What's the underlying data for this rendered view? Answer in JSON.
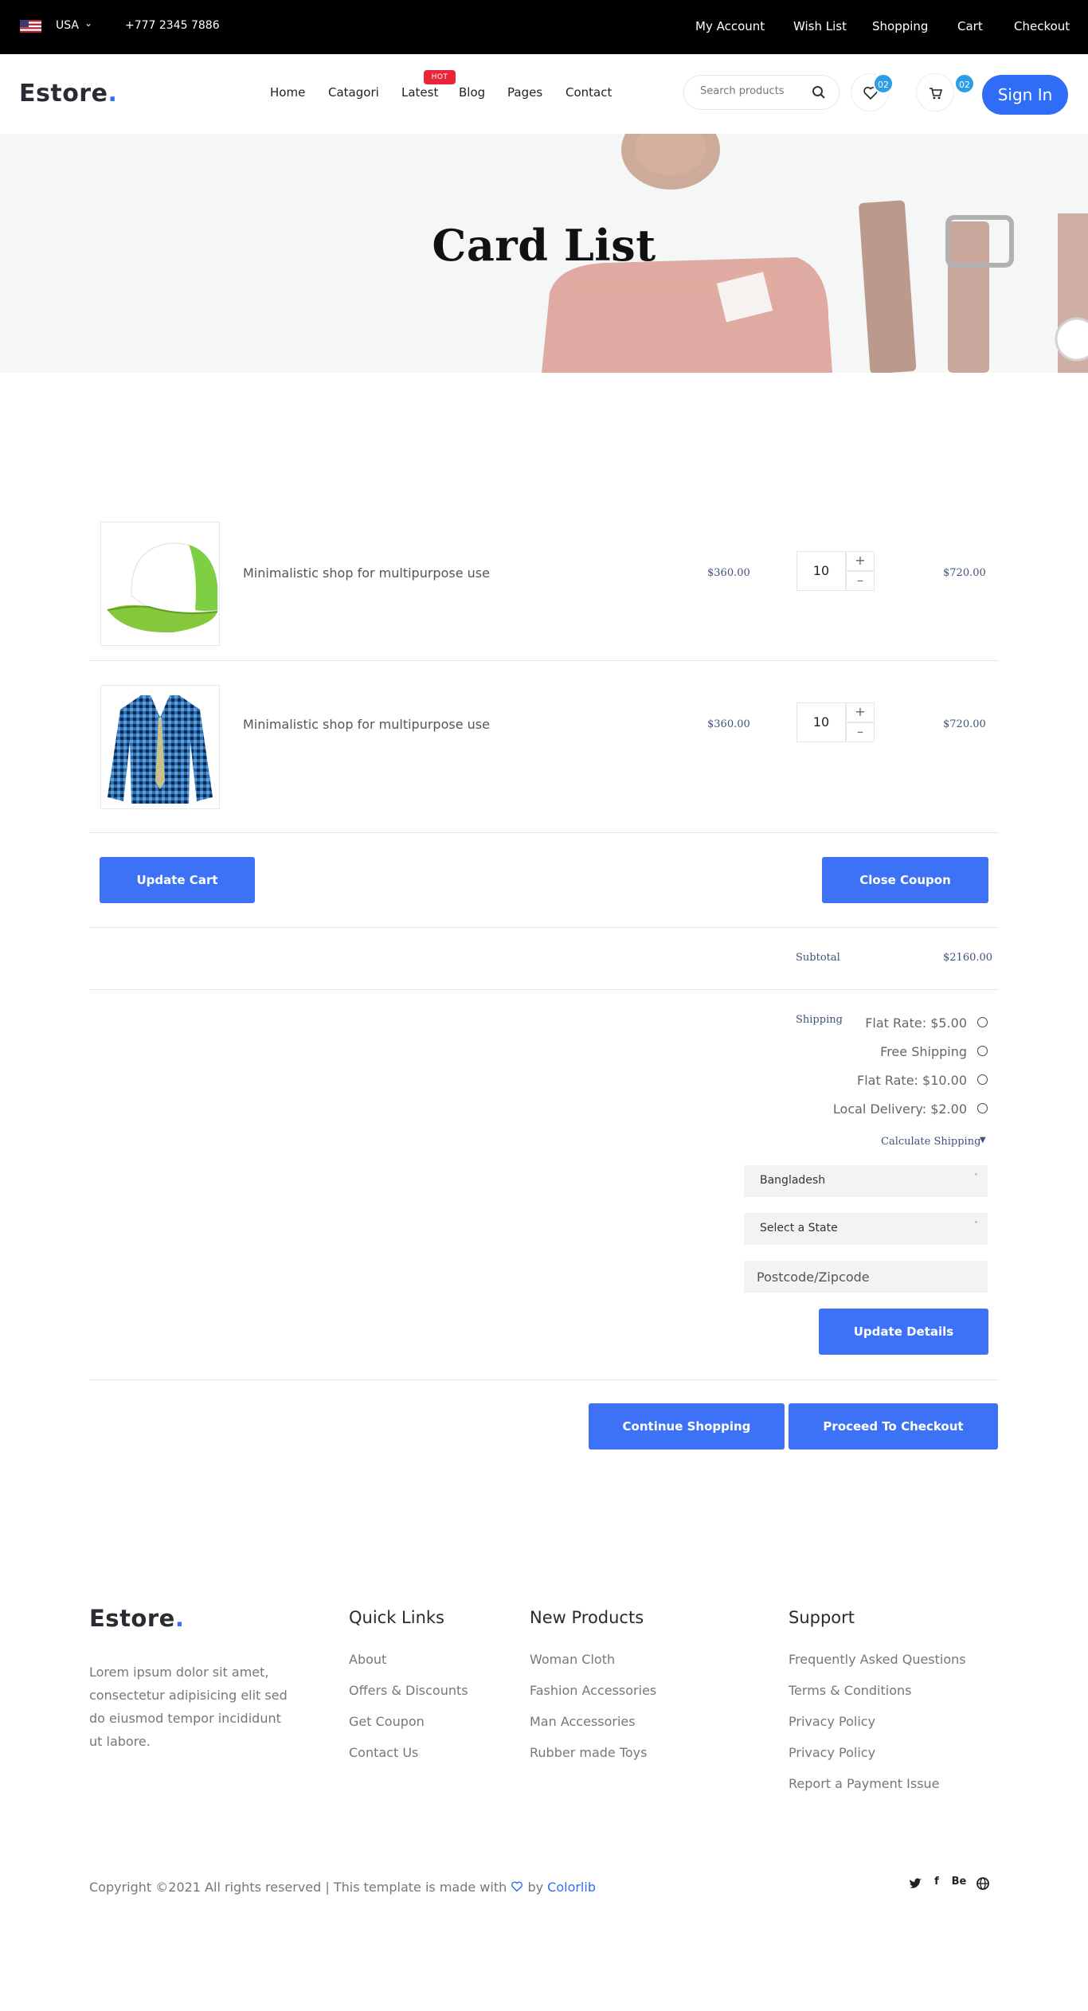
{
  "topbar": {
    "country": "USA",
    "phone": "+777 2345 7886",
    "links": [
      "My Account",
      "Wish List",
      "Shopping",
      "Cart",
      "Checkout"
    ]
  },
  "header": {
    "logo_text": "Estore",
    "logo_dot": ".",
    "nav": [
      "Home",
      "Catagori",
      "Latest",
      "Blog",
      "Pages",
      "Contact"
    ],
    "hot_badge": "HOT",
    "search_placeholder": "Search products",
    "wishlist_count": "02",
    "cart_count": "02",
    "signin_label": "Sign In"
  },
  "hero": {
    "title": "Card List"
  },
  "cart": {
    "items": [
      {
        "name": "Minimalistic shop for multipurpose use",
        "price": "$360.00",
        "quantity": "10",
        "total": "$720.00",
        "image": "green-cap"
      },
      {
        "name": "Minimalistic shop for multipurpose use",
        "price": "$360.00",
        "quantity": "10",
        "total": "$720.00",
        "image": "plaid-shirt"
      }
    ],
    "update_cart_label": "Update Cart",
    "close_coupon_label": "Close Coupon",
    "subtotal_label": "Subtotal",
    "subtotal_value": "$2160.00",
    "shipping_label": "Shipping",
    "shipping_options": [
      "Flat Rate: $5.00",
      "Free Shipping",
      "Flat Rate: $10.00",
      "Local Delivery: $2.00"
    ],
    "calculate_shipping_label": "Calculate Shipping",
    "country_select": "Bangladesh",
    "state_select": "Select a State",
    "postcode_placeholder": "Postcode/Zipcode",
    "update_details_label": "Update Details",
    "continue_label": "Continue Shopping",
    "checkout_label": "Proceed To Checkout"
  },
  "footer": {
    "logo_text": "Estore",
    "logo_dot": ".",
    "description": "Lorem ipsum dolor sit amet, consectetur adipisicing elit sed do eiusmod tempor incididunt ut labore.",
    "quick_links": {
      "title": "Quick Links",
      "items": [
        "About",
        "Offers & Discounts",
        "Get Coupon",
        "Contact Us"
      ]
    },
    "new_products": {
      "title": "New Products",
      "items": [
        "Woman Cloth",
        "Fashion Accessories",
        "Man Accessories",
        "Rubber made Toys"
      ]
    },
    "support": {
      "title": "Support",
      "items": [
        "Frequently Asked Questions",
        "Terms & Conditions",
        "Privacy Policy",
        "Privacy Policy",
        "Report a Payment Issue"
      ]
    },
    "copyright_prefix": "Copyright ©2021 All rights reserved | This template is made with",
    "copyright_by": "by",
    "copyright_link": "Colorlib",
    "social_icons": [
      "twitter-icon",
      "facebook-icon",
      "behance-icon",
      "globe-icon"
    ],
    "social_labels": {
      "facebook": "f",
      "behance": "Be"
    }
  },
  "colors": {
    "accent": "#3d72f6",
    "badge_hot": "#e8253a",
    "count_badge": "#2f9de6",
    "topbar": "#000000"
  }
}
